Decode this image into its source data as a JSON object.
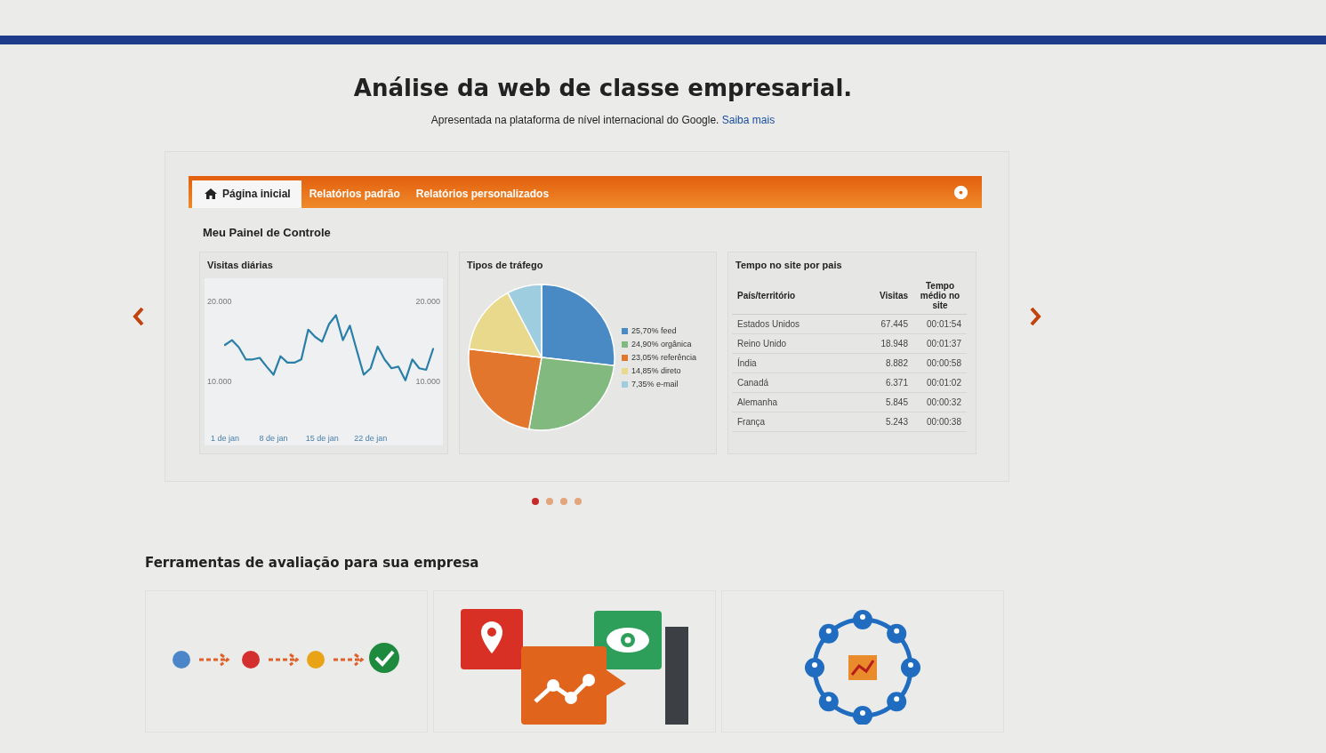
{
  "hero": {
    "title": "Análise da web de classe empresarial.",
    "subtitle": "Apresentada na plataforma de nível internacional do Google.",
    "link": "Saiba mais"
  },
  "tabs": [
    {
      "label": "Página inicial",
      "selected": true
    },
    {
      "label": "Relatórios padrão",
      "selected": false
    },
    {
      "label": "Relatórios personalizados",
      "selected": false
    }
  ],
  "dashboard_title": "Meu Painel de Controle",
  "widgets": {
    "daily_visits": {
      "title": "Visitas diárias",
      "chart_data": {
        "type": "line",
        "categories": [
          "1 de jan",
          null,
          null,
          null,
          null,
          null,
          null,
          "8 de jan",
          null,
          null,
          null,
          null,
          null,
          null,
          "15 de jan",
          null,
          null,
          null,
          null,
          null,
          null,
          "22 de jan",
          null,
          null,
          null,
          null,
          null,
          null,
          null,
          null,
          null
        ],
        "yticks": [
          {
            "value": 10000,
            "label": "10.000"
          },
          {
            "value": 20000,
            "label": "20.000"
          }
        ],
        "ylim": [
          2000,
          23000
        ],
        "series": [
          {
            "color": "#2a7fa8",
            "values": [
              14600,
              15200,
              14300,
              12800,
              12800,
              13000,
              11900,
              10900,
              13200,
              12400,
              12400,
              12800,
              16500,
              15600,
              15000,
              17200,
              18300,
              15200,
              17000,
              13900,
              10900,
              11700,
              14400,
              12800,
              11700,
              11900,
              10200,
              12800,
              11700,
              11500,
              14100
            ]
          }
        ]
      }
    },
    "traffic_types": {
      "title": "Tipos de tráfego",
      "chart_data": {
        "type": "pie",
        "categories": [
          "25,70% feed",
          "24,90% orgânica",
          "23,05% referência",
          "14,85% direto",
          "7,35% e-mail"
        ],
        "series": [
          {
            "values": [
              25.7,
              24.9,
              23.05,
              14.85,
              7.35
            ]
          }
        ],
        "legend": "right",
        "colors": [
          "#4a8ac4",
          "#82b97f",
          "#e2762c",
          "#e8d98c",
          "#9fcde0"
        ]
      }
    },
    "time_by_country": {
      "title": "Tempo no site por pais",
      "columns": [
        "País/território",
        "Visitas",
        "Tempo médio no site"
      ],
      "rows": [
        [
          "Estados Unidos",
          "67.445",
          "00:01:54"
        ],
        [
          "Reino Unido",
          "18.948",
          "00:01:37"
        ],
        [
          "Índia",
          "8.882",
          "00:00:58"
        ],
        [
          "Canadá",
          "6.371",
          "00:01:02"
        ],
        [
          "Alemanha",
          "5.845",
          "00:00:32"
        ],
        [
          "França",
          "5.243",
          "00:00:38"
        ]
      ]
    }
  },
  "carousel_dots": [
    {
      "selected": true
    },
    {
      "selected": false
    },
    {
      "selected": false
    },
    {
      "selected": false
    }
  ],
  "tools_title": "Ferramentas de avaliação para sua empresa"
}
